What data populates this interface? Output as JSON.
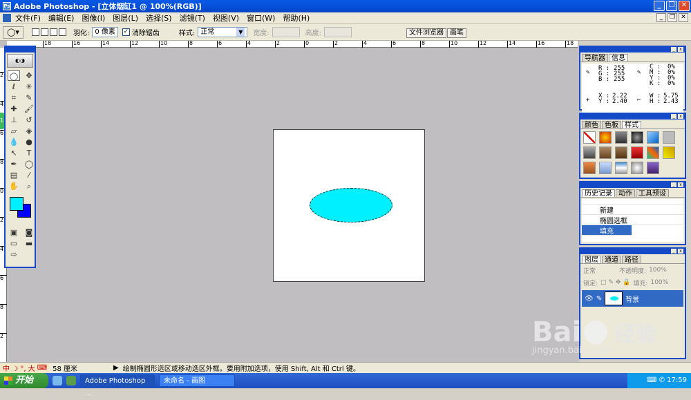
{
  "app": {
    "title": "Adobe Photoshop - [立体烟缸1 @ 100%(RGB)]",
    "icon": "ps-icon"
  },
  "window_controls": {
    "minimize": "_",
    "restore": "❐",
    "close": "✕"
  },
  "menus": [
    "文件(F)",
    "编辑(E)",
    "图像(I)",
    "图层(L)",
    "选择(S)",
    "滤镜(T)",
    "视图(V)",
    "窗口(W)",
    "帮助(H)"
  ],
  "options": {
    "feather_label": "羽化:",
    "feather_value": "0 像素",
    "antialias_label": "消除锯齿",
    "antialias_checked": "✓",
    "style_label": "样式:",
    "style_value": "正常",
    "width_label": "宽度:",
    "height_label": "高度:"
  },
  "palette_well": [
    "文件浏览器",
    "画笔"
  ],
  "rulers": {
    "top": [
      "18",
      "16",
      "14",
      "12",
      "10",
      "8",
      "6",
      "4",
      "2",
      "0",
      "2",
      "4",
      "6",
      "8",
      "10",
      "12",
      "14",
      "16",
      "18",
      "20",
      "22",
      "24"
    ],
    "left": [
      "2",
      "4",
      "6",
      "8",
      "0",
      "2",
      "4",
      "6",
      "8",
      "2",
      "4",
      "6"
    ]
  },
  "document": {
    "background": "#ffffff",
    "selection_fill": "#00f0ff"
  },
  "toolbox": {
    "foreground": "#00f0ff",
    "background": "#0000ff",
    "badge": "18"
  },
  "info_panel": {
    "tabs": [
      "导航器",
      "信息"
    ],
    "rgb": {
      "R": "255",
      "G": "255",
      "B": "255"
    },
    "cmyk": {
      "C": "0%",
      "M": "0%",
      "Y": "0%",
      "K": "0%"
    },
    "xy": {
      "X": "2.22",
      "Y": "2.40"
    },
    "wh": {
      "W": "5.75",
      "H": "2.43"
    }
  },
  "styles_panel": {
    "tabs": [
      "颜色",
      "色板",
      "样式"
    ]
  },
  "history_panel": {
    "tabs": [
      "历史记录",
      "动作",
      "工具预设"
    ],
    "items": [
      "新建",
      "椭圆选框",
      "填充"
    ]
  },
  "layers_panel": {
    "tabs": [
      "图层",
      "通道",
      "路径"
    ],
    "mode": "正常",
    "opacity_label": "不透明度:",
    "opacity_value": "100%",
    "lock_label": "锁定:",
    "fill_label": "填充:",
    "fill_value": "100%",
    "layer_name": "背景"
  },
  "status": {
    "ime": "中 ☽ °, 大",
    "doc_size": "58 厘米",
    "hint": "绘制椭圆形选区或移动选区外框。要用附加选项，使用 Shift, Alt 和 Ctrl 键。"
  },
  "taskbar": {
    "start": "开始",
    "tasks": [
      "Adobe Photoshop ...",
      "未命名 - 画图"
    ],
    "clock": "17:59"
  },
  "watermark": {
    "main": "Bai",
    "cn": "经验",
    "url": "jingyan.baidu.com"
  }
}
